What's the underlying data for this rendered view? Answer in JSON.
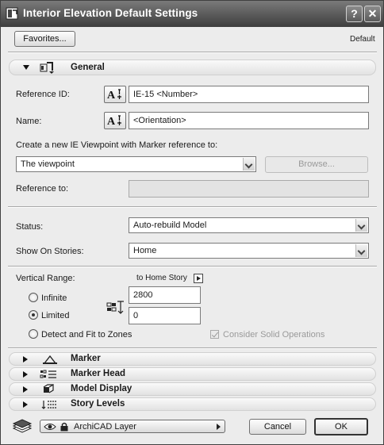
{
  "window": {
    "title": "Interior Elevation Default Settings",
    "help_label": "?",
    "close_label": "✕"
  },
  "top": {
    "favorites_label": "Favorites...",
    "default_label": "Default"
  },
  "general": {
    "label": "General",
    "reference_id_label": "Reference ID:",
    "reference_id_value": "IE-15 <Number>",
    "name_label": "Name:",
    "name_value": "<Orientation>",
    "create_label": "Create a new IE Viewpoint with Marker reference to:",
    "viewpoint_select": "The viewpoint",
    "browse_label": "Browse...",
    "reference_to_label": "Reference to:",
    "reference_to_value": ""
  },
  "status": {
    "status_label": "Status:",
    "status_value": "Auto-rebuild Model",
    "show_on_stories_label": "Show On Stories:",
    "show_on_stories_value": "Home"
  },
  "vertical_range": {
    "label": "Vertical Range:",
    "to_story_label": "to Home Story",
    "options": [
      "Infinite",
      "Limited",
      "Detect and Fit to Zones"
    ],
    "selected": "Limited",
    "top_value": "2800",
    "bottom_value": "0",
    "consider_solid_label": "Consider Solid Operations",
    "consider_solid_checked": true
  },
  "panels": [
    {
      "label": "Marker"
    },
    {
      "label": "Marker Head"
    },
    {
      "label": "Model Display"
    },
    {
      "label": "Story Levels"
    }
  ],
  "bottom": {
    "layer_value": "ArchiCAD Layer",
    "cancel_label": "Cancel",
    "ok_label": "OK"
  }
}
